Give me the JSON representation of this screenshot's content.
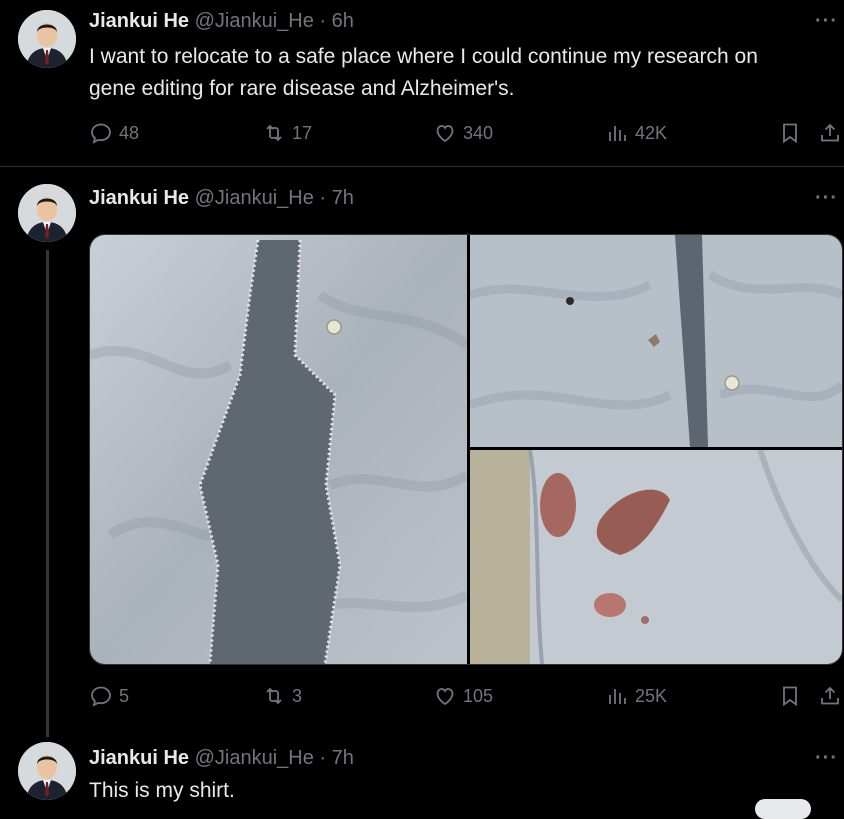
{
  "tweets": [
    {
      "name": "Jiankui He",
      "handle": "@Jiankui_He",
      "time": "· 6h",
      "text_line1": "I want to relocate to a safe place where I could continue my research on",
      "text_line2": "gene editing for rare disease and Alzheimer's.",
      "replies": "48",
      "retweets": "17",
      "likes": "340",
      "views": "42K"
    },
    {
      "name": "Jiankui He",
      "handle": "@Jiankui_He",
      "time": "· 7h",
      "replies": "5",
      "retweets": "3",
      "likes": "105",
      "views": "25K"
    },
    {
      "name": "Jiankui He",
      "handle": "@Jiankui_He",
      "time": "· 7h",
      "text_line1": "This is my shirt."
    }
  ],
  "icons": {
    "more": "more-dots-icon",
    "reply": "reply-icon",
    "retweet": "retweet-icon",
    "like": "heart-icon",
    "views": "views-chart-icon",
    "bookmark": "bookmark-icon",
    "share": "share-icon"
  },
  "colors": {
    "background": "#000000",
    "text": "#e7e9ea",
    "muted": "#71767b",
    "divider": "#2f3336"
  },
  "more_glyph": "···"
}
